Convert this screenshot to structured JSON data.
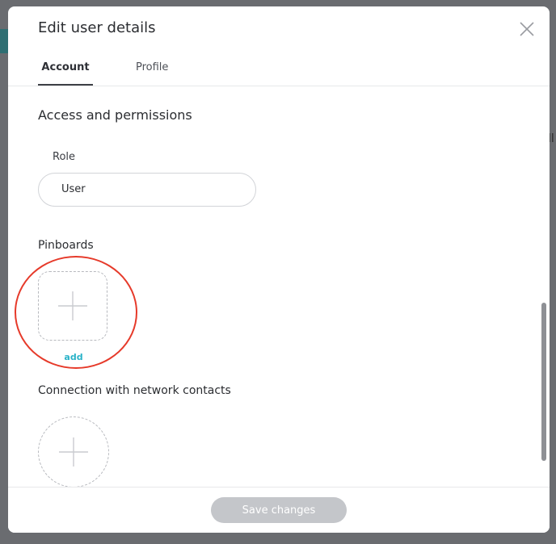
{
  "background": {
    "right_snippet": "ll"
  },
  "modal": {
    "title": "Edit user details",
    "tabs": [
      {
        "label": "Account",
        "active": true
      },
      {
        "label": "Profile",
        "active": false
      }
    ],
    "access_section_title": "Access and permissions",
    "role": {
      "label": "Role",
      "value": "User"
    },
    "pinboards": {
      "title": "Pinboards",
      "add_label": "add"
    },
    "connection": {
      "title": "Connection with network contacts"
    },
    "footer": {
      "save_label": "Save changes"
    },
    "icons": {
      "close": "close-icon",
      "plus": "plus-icon"
    },
    "colors": {
      "accent": "#2ab3c8",
      "highlight": "#e63a2a",
      "save_disabled": "#c4c6ca"
    }
  }
}
